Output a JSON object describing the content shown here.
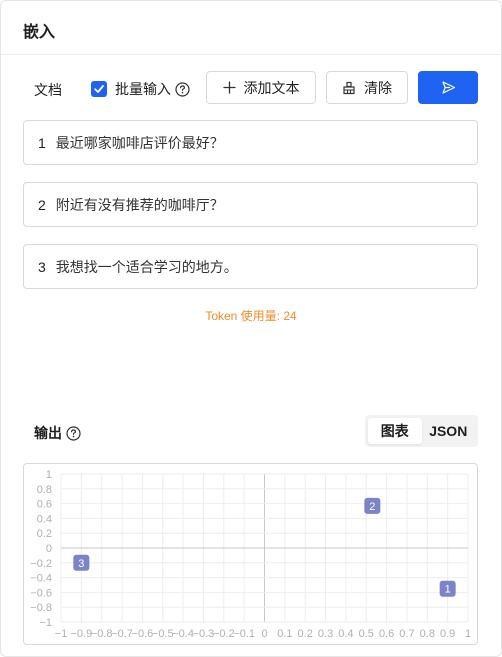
{
  "header": {
    "title": "嵌入"
  },
  "toolbar": {
    "doc_label": "文档",
    "batch_label": "批量输入",
    "batch_checked": true,
    "add_text_label": "添加文本",
    "clear_label": "清除"
  },
  "inputs": [
    {
      "index": "1",
      "text": "最近哪家咖啡店评价最好？"
    },
    {
      "index": "2",
      "text": "附近有没有推荐的咖啡厅？"
    },
    {
      "index": "3",
      "text": "我想找一个适合学习的地方。"
    }
  ],
  "token_usage": "Token 使用量: 24",
  "output": {
    "label": "输出",
    "tabs": [
      {
        "label": "图表",
        "active": true
      },
      {
        "label": "JSON",
        "active": false
      }
    ]
  },
  "colors": {
    "primary": "#1e63f2",
    "token": "#f08c2a",
    "point": "#7b83c9"
  },
  "chart_data": {
    "type": "scatter",
    "xlim": [
      -1,
      1
    ],
    "ylim": [
      -1,
      1
    ],
    "grid": true,
    "x_ticks": [
      "−1",
      "−0.9",
      "−0.8",
      "−0.7",
      "−0.6",
      "−0.5",
      "−0.4",
      "−0.3",
      "−0.2",
      "−0.1",
      "0",
      "0.1",
      "0.2",
      "0.3",
      "0.4",
      "0.5",
      "0.6",
      "0.7",
      "0.8",
      "0.9",
      "1"
    ],
    "y_ticks": [
      "1",
      "0.8",
      "0.6",
      "0.4",
      "0.2",
      "0",
      "−0.2",
      "−0.4",
      "−0.6",
      "−0.8",
      "−1"
    ],
    "points": [
      {
        "label": "1",
        "x": 0.9,
        "y": -0.55
      },
      {
        "label": "2",
        "x": 0.53,
        "y": 0.57
      },
      {
        "label": "3",
        "x": -0.9,
        "y": -0.2
      }
    ]
  }
}
